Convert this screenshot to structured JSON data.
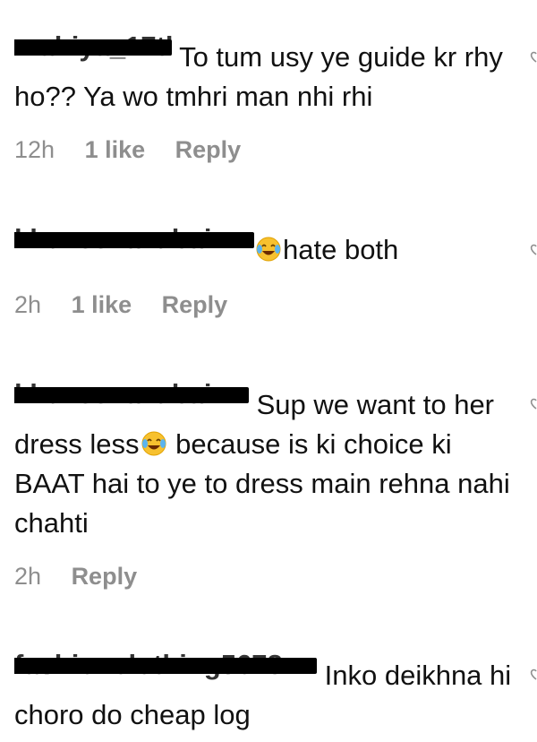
{
  "comments": [
    {
      "username": "mahiya_17th",
      "text": "To tum usy ye guide kr rhy ho?? Ya wo tmhri man nhi rhi",
      "time": "12h",
      "likes": "1 like",
      "reply": "Reply"
    },
    {
      "username": "khuzeenazubair",
      "emoji": "face-with-tears-of-joy",
      "text": "hate both",
      "time": "2h",
      "likes": "1 like",
      "reply": "Reply"
    },
    {
      "username": "khuzeenazubair",
      "text_a": "Sup we want to her dress less",
      "emoji": "face-with-tears-of-joy",
      "text_b": " because is ki choice ki BAAT hai to ye to dress main rehna nahi chahti",
      "time": "2h",
      "reply": "Reply"
    },
    {
      "username": "fashionclothing5678",
      "text": "Inko deikhna hi choro do cheap log"
    }
  ],
  "icons": {
    "like": "heart-outline-icon"
  },
  "colors": {
    "text": "#111111",
    "meta": "#8e8e8e"
  }
}
